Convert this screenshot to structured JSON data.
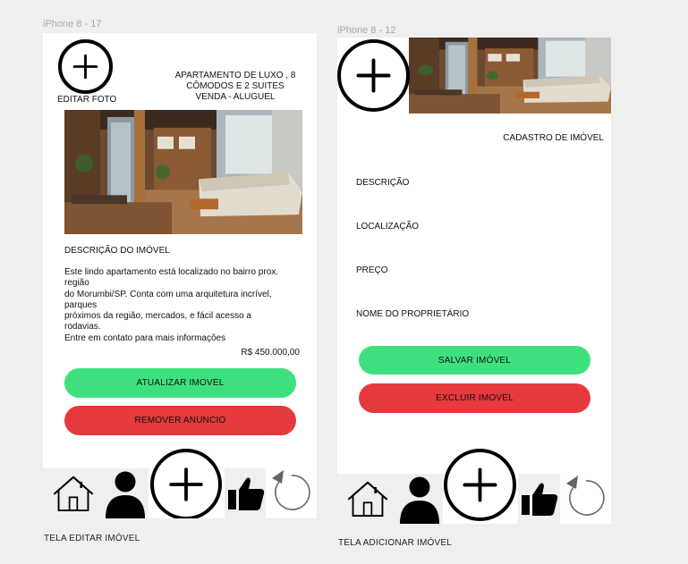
{
  "frames": {
    "left": {
      "frame_label": "iPhone 8 - 17",
      "caption": "TELA EDITAR IMÓVEL",
      "edit_photo_label": "EDITAR FOTO",
      "title_lines": [
        "APARTAMENTO DE LUXO , 8",
        "CÔMODOS E 2 SUITES",
        "VENDA - ALUGUEL"
      ],
      "description_heading": "DESCRIÇÃO DO IMÓVEL",
      "description_lines": [
        "Este lindo apartamento está localizado no bairro prox.",
        "região",
        "do Morumbi/SP. Conta com uma arquitetura incrível,",
        "parques",
        "próximos da região, mercados, e fácil acesso a",
        "rodavias.",
        "Entre em contato para mais informações"
      ],
      "price": "R$ 450.000,00",
      "update_button": "ATUALIZAR IMOVEL",
      "remove_button": "REMOVER ANUNCIO"
    },
    "right": {
      "frame_label": "iPhone 8 - 12",
      "caption": "TELA ADICIONAR IMÓVEL",
      "page_title": "CADASTRO DE IMÓVEL",
      "fields": [
        "DESCRIÇÃO",
        "LOCALIZAÇÃO",
        "PREÇO",
        "NOME DO PROPRIETÁRIO"
      ],
      "save_button": "SALVAR IMÓVEL",
      "delete_button": "EXCLUIR IMOVEL"
    }
  },
  "navbar_icons": [
    "home-icon",
    "user-icon",
    "add-icon",
    "thumbs-up-icon",
    "refresh-icon"
  ],
  "colors": {
    "green": "#3ee07e",
    "red": "#e5393d",
    "background": "#efefef"
  }
}
